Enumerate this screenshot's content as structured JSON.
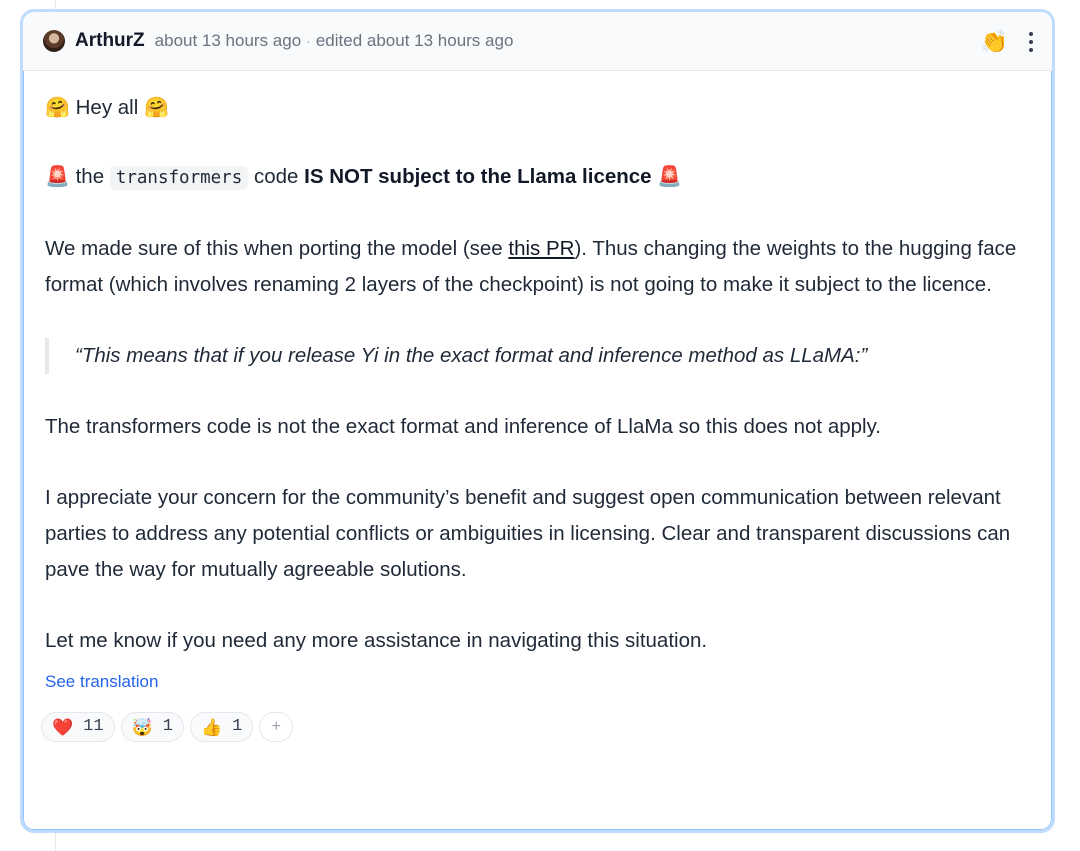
{
  "comment": {
    "author": "ArthurZ",
    "posted": "about 13 hours ago",
    "separator": "·",
    "edited": "edited about 13 hours ago",
    "header_emoji": "👏",
    "greeting": {
      "emoji_left": "🤗",
      "text": "Hey all",
      "emoji_right": "🤗"
    },
    "notice": {
      "emoji_left": "🚨",
      "pre": "the",
      "code": "transformers",
      "mid": "code",
      "bold": "IS NOT subject to the Llama licence",
      "emoji_right": "🚨"
    },
    "para1": {
      "pre": "We made sure of this when porting the model (see ",
      "link": "this PR",
      "post": "). Thus changing the weights to the hugging face format (which involves renaming 2 layers of the checkpoint) is not going to make it subject to the licence."
    },
    "quote": "“This means that if you release Yi in the exact format and inference method as LLaMA:”",
    "para2": "The transformers code is not the exact format and inference of LlaMa so this does not apply.",
    "para3": "I appreciate your concern for the community’s benefit and suggest open communication between relevant parties to address any potential conflicts or ambiguities in licensing. Clear and transparent discussions can pave the way for mutually agreeable solutions.",
    "para4": "Let me know if you need any more assistance in navigating this situation.",
    "see_translation": "See translation",
    "reactions": [
      {
        "emoji": "❤️",
        "count": "11",
        "icon": "heart-icon"
      },
      {
        "emoji": "🤯",
        "count": "1",
        "icon": "exploding-head-icon"
      },
      {
        "emoji": "👍",
        "count": "1",
        "icon": "thumbs-up-icon"
      }
    ],
    "add_reaction": "+"
  },
  "colors": {
    "card_border": "#bfdbfe",
    "link_blue": "#2563eb",
    "header_bg": "#f9fafb"
  }
}
